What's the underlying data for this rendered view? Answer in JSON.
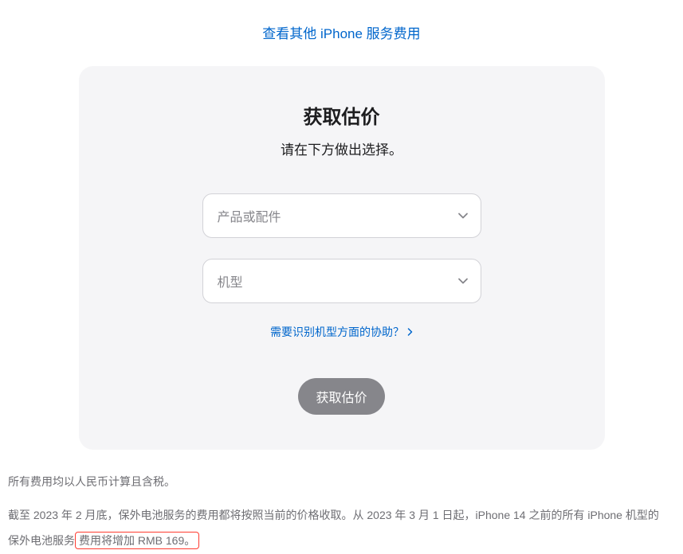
{
  "header": {
    "service_link": "查看其他 iPhone 服务费用"
  },
  "card": {
    "title": "获取估价",
    "subtitle": "请在下方做出选择。",
    "product_select_placeholder": "产品或配件",
    "model_select_placeholder": "机型",
    "help_link": "需要识别机型方面的协助？",
    "submit_button": "获取估价"
  },
  "footnotes": {
    "line1": "所有费用均以人民币计算且含税。",
    "line2_prefix": "截至 2023 年 2 月底，保外电池服务的费用都将按照当前的价格收取。从 2023 年 3 月 1 日起，iPhone 14 之前的所有 iPhone 机型的保外电池服务",
    "line2_highlight": "费用将增加 RMB 169。"
  }
}
